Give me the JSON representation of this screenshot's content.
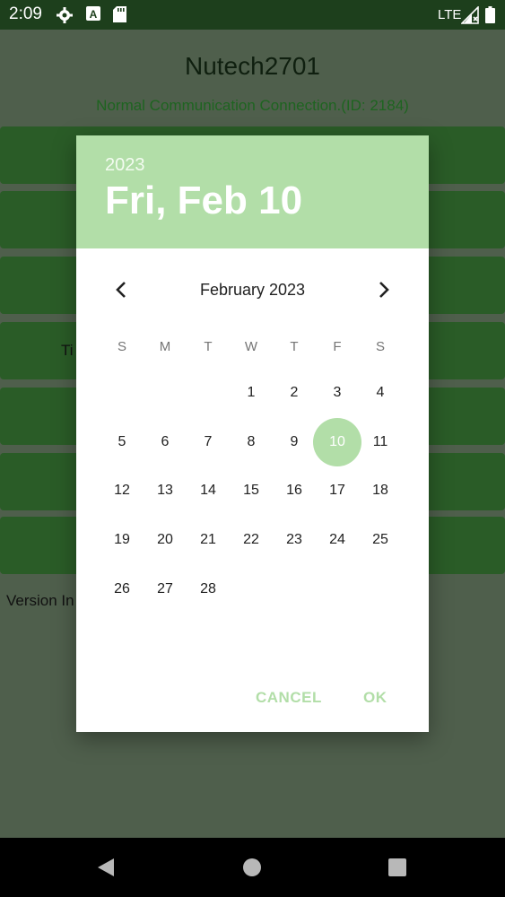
{
  "status_bar": {
    "time": "2:09",
    "network": "LTE",
    "icons": [
      "gear-icon",
      "a-notification-icon",
      "sd-card-icon",
      "signal-icon",
      "battery-icon"
    ]
  },
  "app": {
    "title": "Nutech2701",
    "status": "Normal Communication Connection.(ID: 2184)",
    "partial_label": "Ti",
    "version_partial": "Version In"
  },
  "dialog": {
    "header_year": "2023",
    "header_date": "Fri, Feb 10",
    "month_label": "February 2023",
    "weekdays": [
      "S",
      "M",
      "T",
      "W",
      "T",
      "F",
      "S"
    ],
    "selected_day": 10,
    "weeks": [
      [
        "",
        "",
        "",
        "1",
        "2",
        "3",
        "4"
      ],
      [
        "5",
        "6",
        "7",
        "8",
        "9",
        "10",
        "11"
      ],
      [
        "12",
        "13",
        "14",
        "15",
        "16",
        "17",
        "18"
      ],
      [
        "19",
        "20",
        "21",
        "22",
        "23",
        "24",
        "25"
      ],
      [
        "26",
        "27",
        "28",
        "",
        "",
        "",
        ""
      ]
    ],
    "cancel_label": "CANCEL",
    "ok_label": "OK"
  },
  "colors": {
    "accent": "#b2dea8",
    "status_bar": "#1d3f1c",
    "app_button": "#2a5c27"
  }
}
